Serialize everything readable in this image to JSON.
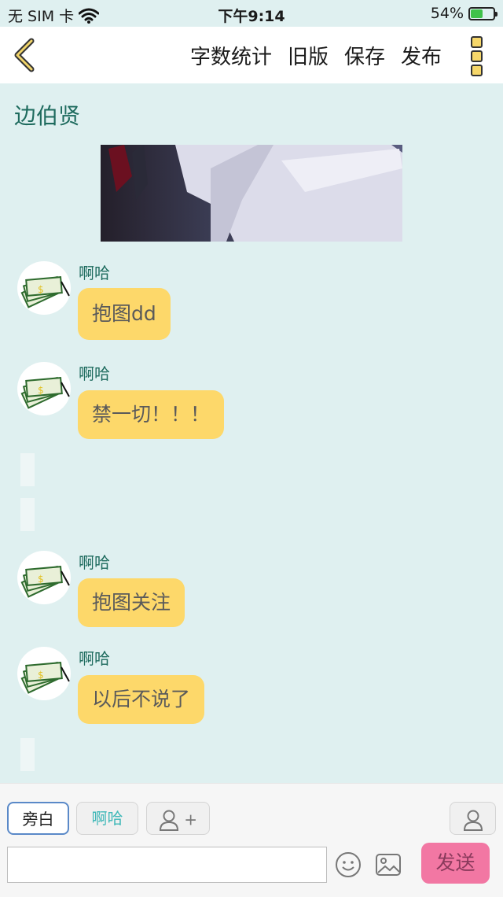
{
  "status": {
    "carrier": "无 SIM 卡",
    "time": "下午9:14",
    "battery_percent": "54%",
    "battery_level": 0.54
  },
  "nav": {
    "back_icon": "chevron-left-icon",
    "actions": [
      "字数统计",
      "旧版",
      "保存",
      "发布"
    ],
    "more_icon": "more-vertical-icon"
  },
  "chat": {
    "title": "边伯贤",
    "messages": [
      {
        "sender": "啊哈",
        "text": "抱图dd"
      },
      {
        "sender": "啊哈",
        "text": "禁一切！！！"
      },
      {
        "sender": "啊哈",
        "text": "抱图关注"
      },
      {
        "sender": "啊哈",
        "text": "以后不说了"
      }
    ]
  },
  "composer": {
    "roles": {
      "narrator": "旁白",
      "aha": "啊哈",
      "add_plus": "+"
    },
    "input_placeholder": "",
    "send_label": "发送"
  },
  "colors": {
    "background": "#dff0f0",
    "bubble": "#fdd86a",
    "name_text": "#1e6b5e",
    "send_button": "#f277a3"
  }
}
